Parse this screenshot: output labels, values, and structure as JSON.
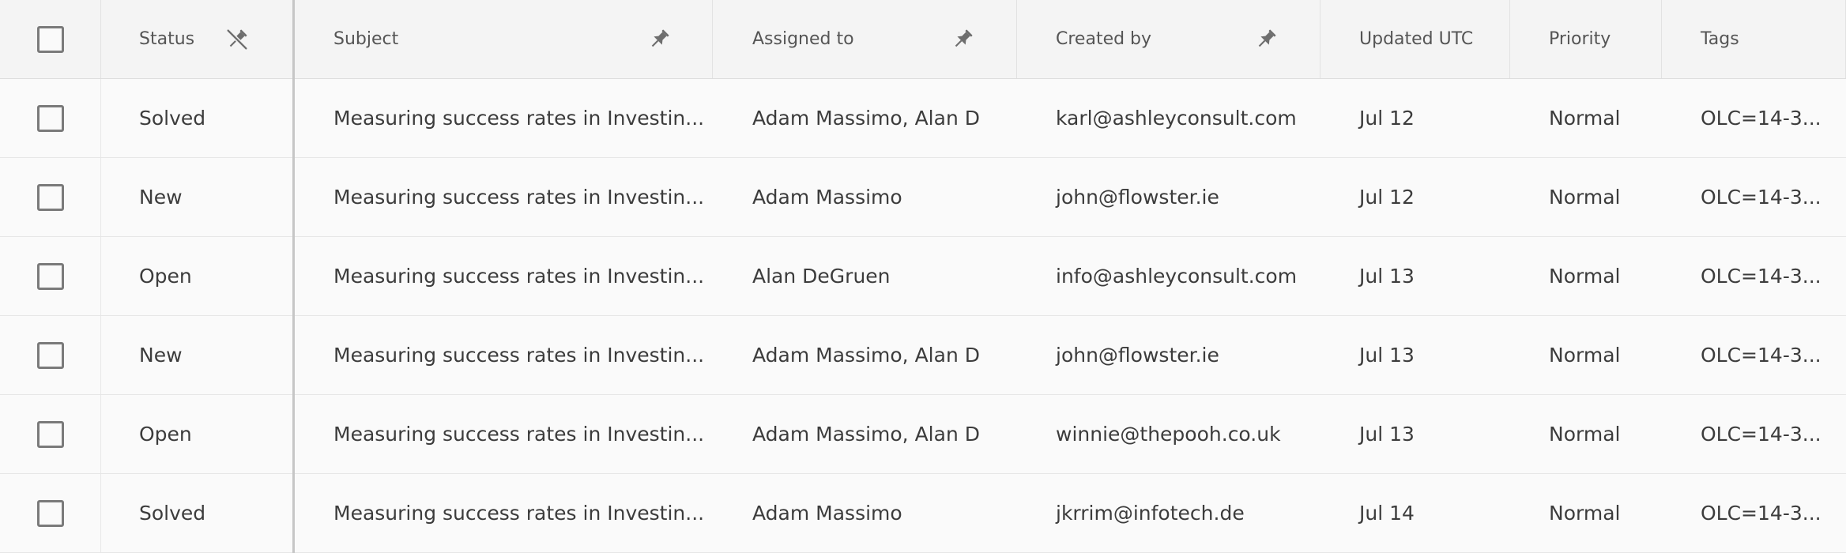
{
  "columns": {
    "status": "Status",
    "subject": "Subject",
    "assigned_to": "Assigned to",
    "created_by": "Created by",
    "updated_utc": "Updated UTC",
    "priority": "Priority",
    "tags": "Tags"
  },
  "icons": {
    "status_pin": "unpin-icon",
    "subject_pin": "pin-icon",
    "assigned_pin": "pin-icon",
    "created_pin": "pin-icon"
  },
  "colors": {
    "header_bg": "#f4f4f4",
    "row_bg": "#fafafa",
    "text": "#3c3c3c",
    "icon": "#6e6e6e",
    "frozen_divider": "#c6c6c6"
  },
  "rows": [
    {
      "status": "Solved",
      "subject": "Measuring success rates in Investin...",
      "assigned_to": "Adam Massimo, Alan D",
      "created_by": "karl@ashleyconsult.com",
      "updated": "Jul 12",
      "priority": "Normal",
      "tags": "OLC=14-3..."
    },
    {
      "status": "New",
      "subject": "Measuring success rates in Investin...",
      "assigned_to": "Adam Massimo",
      "created_by": "john@flowster.ie",
      "updated": "Jul 12",
      "priority": "Normal",
      "tags": "OLC=14-3..."
    },
    {
      "status": "Open",
      "subject": "Measuring success rates in Investin...",
      "assigned_to": "Alan DeGruen",
      "created_by": "info@ashleyconsult.com",
      "updated": "Jul 13",
      "priority": "Normal",
      "tags": "OLC=14-3..."
    },
    {
      "status": "New",
      "subject": "Measuring success rates in Investin...",
      "assigned_to": "Adam Massimo, Alan D",
      "created_by": "john@flowster.ie",
      "updated": "Jul 13",
      "priority": "Normal",
      "tags": "OLC=14-3..."
    },
    {
      "status": "Open",
      "subject": "Measuring success rates in Investin...",
      "assigned_to": "Adam Massimo, Alan D",
      "created_by": "winnie@thepooh.co.uk",
      "updated": "Jul 13",
      "priority": "Normal",
      "tags": "OLC=14-3..."
    },
    {
      "status": "Solved",
      "subject": "Measuring success rates in Investin...",
      "assigned_to": "Adam Massimo",
      "created_by": "jkrrim@infotech.de",
      "updated": "Jul 14",
      "priority": "Normal",
      "tags": "OLC=14-3..."
    }
  ]
}
